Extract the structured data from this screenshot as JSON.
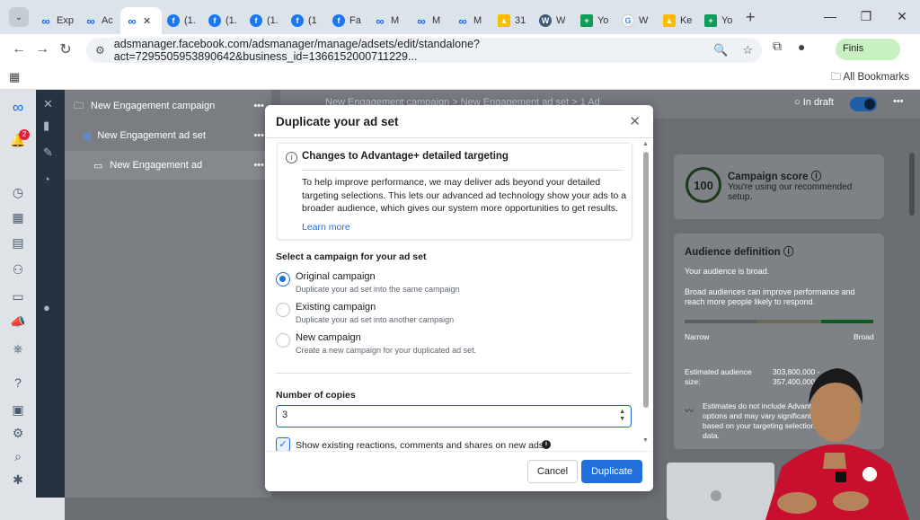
{
  "browser": {
    "tabs": [
      {
        "icon": "meta-icon",
        "label": "Exp"
      },
      {
        "icon": "meta-icon",
        "label": "Ac"
      },
      {
        "icon": "meta-icon",
        "label": ""
      },
      {
        "icon": "facebook-icon",
        "label": "(1."
      },
      {
        "icon": "facebook-icon",
        "label": "(1."
      },
      {
        "icon": "facebook-icon",
        "label": "(1."
      },
      {
        "icon": "facebook-icon",
        "label": "(1"
      },
      {
        "icon": "facebook-icon",
        "label": "Fa"
      },
      {
        "icon": "meta-icon",
        "label": "M"
      },
      {
        "icon": "meta-icon",
        "label": "M"
      },
      {
        "icon": "meta-icon",
        "label": "M"
      },
      {
        "icon": "drive-icon",
        "label": "31"
      },
      {
        "icon": "wordpress-icon",
        "label": "W"
      },
      {
        "icon": "sheets-icon",
        "label": "Yo"
      },
      {
        "icon": "google-icon",
        "label": "W"
      },
      {
        "icon": "google-ads-icon",
        "label": "Ke"
      },
      {
        "icon": "sheets-icon",
        "label": "Yo"
      }
    ],
    "url": "adsmanager.facebook.com/adsmanager/manage/adsets/edit/standalone?act=7295505953890642&business_id=1366152000711229...",
    "finish_label": "Finis",
    "all_bookmarks": "All Bookmarks"
  },
  "tree": {
    "campaign": "New Engagement campaign",
    "adset": "New Engagement ad set",
    "ad": "New Engagement ad",
    "more": "•••"
  },
  "header": {
    "breadcrumb": "New Engagement campaign  >  New Engagement ad set  >  1 Ad",
    "status": "In draft",
    "notification_count": "2"
  },
  "right_panel": {
    "score": "100",
    "score_title": "Campaign score",
    "score_desc": "You're using our recommended setup.",
    "audience_title": "Audience definition",
    "audience_broad": "Your audience is broad.",
    "audience_note": "Broad audiences can improve performance and reach more people likely to respond.",
    "narrow": "Narrow",
    "broad": "Broad",
    "est_label": "Estimated audience size:",
    "est_value": "303,800,000 - 357,400,000",
    "estimates_note": "Estimates do not include Advantage+ options and may vary significantly based on your targeting selections and data."
  },
  "modal": {
    "title": "Duplicate your ad set",
    "notice_title": "Changes to Advantage+ detailed targeting",
    "notice_body": "To help improve performance, we may deliver ads beyond your detailed targeting selections. This lets our advanced ad technology show your ads to a broader audience, which gives our system more opportunities to get results.",
    "learn_more": "Learn more",
    "select_label": "Select a campaign for your ad set",
    "options": [
      {
        "title": "Original campaign",
        "desc": "Duplicate your ad set into the same campaign",
        "selected": true
      },
      {
        "title": "Existing campaign",
        "desc": "Duplicate your ad set into another campaign",
        "selected": false
      },
      {
        "title": "New campaign",
        "desc": "Create a new campaign for your duplicated ad set.",
        "selected": false
      }
    ],
    "copies_label": "Number of copies",
    "copies_value": "3",
    "show_reactions": "Show existing reactions, comments and shares on new ads",
    "show_reactions_checked": true,
    "cancel": "Cancel",
    "duplicate": "Duplicate"
  },
  "colors": {
    "primary": "#216fdb",
    "dark_rail": "#253240",
    "overlay": "#6b6f74"
  }
}
